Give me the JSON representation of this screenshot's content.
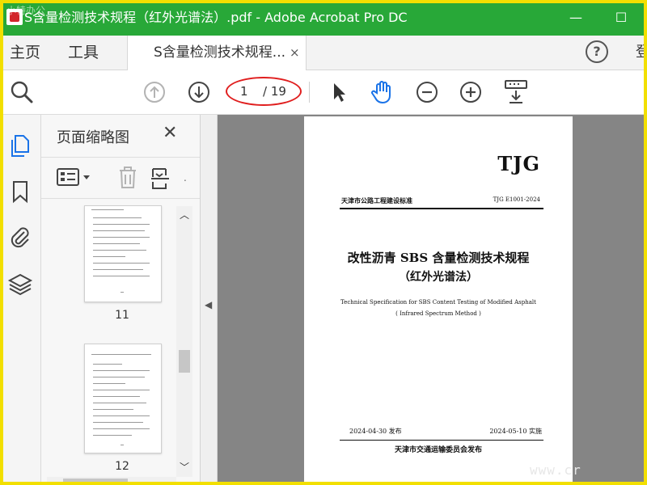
{
  "window": {
    "title": "S含量检测技术规程（红外光谱法）.pdf - Adobe Acrobat Pro DC",
    "watermark": "小特办公",
    "minimize_glyph": "—",
    "maximize_glyph": "☐"
  },
  "tabs": {
    "home": "主页",
    "tools": "工具",
    "document_tab": "S含量检测技术规程...",
    "close_glyph": "×",
    "help_glyph": "?",
    "login_partial": "登"
  },
  "toolbar": {
    "current_page": "1",
    "total_pages": "/ 19",
    "icons": [
      "search-zoom-icon",
      "prev-page-icon",
      "next-page-icon",
      "select-cursor-icon",
      "hand-tool-icon",
      "zoom-out-icon",
      "zoom-in-icon",
      "scroll-mode-icon"
    ]
  },
  "sidebar": {
    "panel_title": "页面缩略图",
    "close_glyph": "✕",
    "thumbnails": [
      {
        "page_label": "11"
      },
      {
        "page_label": "12"
      }
    ]
  },
  "document": {
    "brand": "TJG",
    "organization_header": "天津市公路工程建设标准",
    "standard_code": "TJG E1001-2024",
    "title_zh": "改性沥青 SBS 含量检测技术规程",
    "subtitle_zh": "（红外光谱法）",
    "title_en": "Technical Specification for SBS Content Testing of Modified Asphalt",
    "subtitle_en": "( Infrared Spectrum Method )",
    "issue_date": "2024-04-30 发布",
    "effective_date": "2024-05-10 实施",
    "issuer": "天津市交通运输委员会发布"
  },
  "site_watermark": "www.cr",
  "colors": {
    "titlebar_green": "#28a838",
    "frame_yellow": "#f2df00",
    "active_blue": "#1a73e8",
    "annotation_red": "#e01e1e",
    "doc_background": "#858585"
  }
}
